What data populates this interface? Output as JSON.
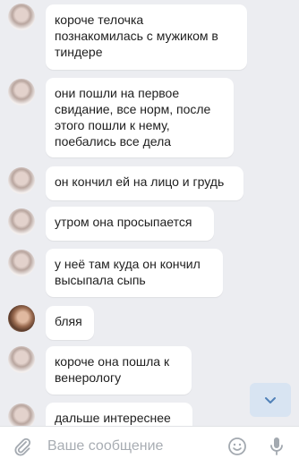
{
  "messages": [
    {
      "text": "короче телочка\nпознакомилась с мужиком в\nтиндере",
      "avatar": "avatar-girl"
    },
    {
      "text": "они пошли на первое\nсвидание, все норм, после\nэтого пошли к нему,\nпоебались все дела",
      "avatar": "avatar-girl"
    },
    {
      "text": "он кончил ей на лицо и грудь",
      "avatar": "avatar-girl"
    },
    {
      "text": "утром она просыпается",
      "avatar": "avatar-girl"
    },
    {
      "text": "у неё там куда он кончил\nвысыпала сыпь",
      "avatar": "avatar-girl"
    },
    {
      "text": "бляя",
      "avatar": "avatar-other"
    },
    {
      "text": "короче она пошла к\nвенерологу",
      "avatar": "avatar-girl"
    },
    {
      "text": "дальше интереснее",
      "avatar": "avatar-girl"
    }
  ],
  "composer": {
    "placeholder": "Ваше сообщение",
    "attach_icon": "paperclip-icon",
    "emoji_icon": "emoji-icon",
    "mic_icon": "microphone-icon"
  },
  "scroll_button": {
    "icon": "chevron-down-icon"
  },
  "colors": {
    "background": "#ecedf1",
    "bubble": "#ffffff",
    "accent": "#5181b8"
  }
}
